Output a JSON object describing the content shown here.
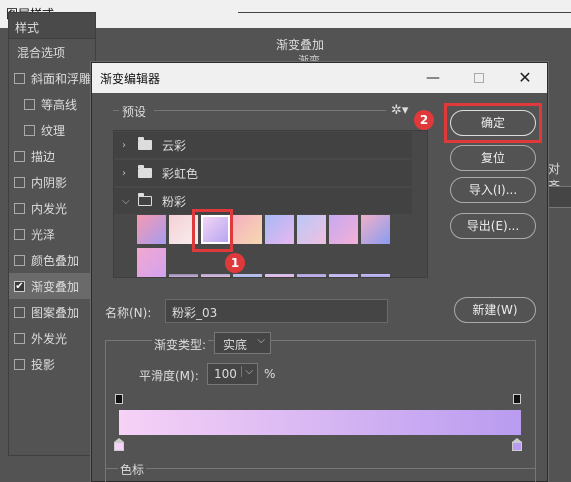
{
  "layer_style": {
    "title": "图层样式",
    "panel_header": "样式",
    "items": [
      {
        "label": "混合选项",
        "checkbox": false,
        "checked": false,
        "indent": false
      },
      {
        "label": "斜面和浮雕",
        "checkbox": true,
        "checked": false,
        "indent": false
      },
      {
        "label": "等高线",
        "checkbox": true,
        "checked": false,
        "indent": true
      },
      {
        "label": "纹理",
        "checkbox": true,
        "checked": false,
        "indent": true
      },
      {
        "label": "描边",
        "checkbox": true,
        "checked": false,
        "indent": false
      },
      {
        "label": "内阴影",
        "checkbox": true,
        "checked": false,
        "indent": false
      },
      {
        "label": "内发光",
        "checkbox": true,
        "checked": false,
        "indent": false
      },
      {
        "label": "光泽",
        "checkbox": true,
        "checked": false,
        "indent": false
      },
      {
        "label": "颜色叠加",
        "checkbox": true,
        "checked": false,
        "indent": false
      },
      {
        "label": "渐变叠加",
        "checkbox": true,
        "checked": true,
        "indent": false
      },
      {
        "label": "图案叠加",
        "checkbox": true,
        "checked": false,
        "indent": false
      },
      {
        "label": "外发光",
        "checkbox": true,
        "checked": false,
        "indent": false
      },
      {
        "label": "投影",
        "checkbox": true,
        "checked": false,
        "indent": false
      }
    ],
    "active_item": "渐变叠加",
    "right_group_title": "渐变叠加",
    "right_sub": "渐变",
    "align_fragment": "对齐"
  },
  "gradient_editor": {
    "title": "渐变编辑器",
    "presets_label": "预设",
    "folders": [
      {
        "name": "云彩",
        "open": false
      },
      {
        "name": "彩虹色",
        "open": false
      },
      {
        "name": "粉彩",
        "open": true
      }
    ],
    "swatches_row1": [
      [
        "#f59ab0",
        "#a79cf0"
      ],
      [
        "#f4d0d4",
        "#f9eef0"
      ],
      [
        "#f3d5f5",
        "#b7a5f2"
      ],
      [
        "#f4b0c0",
        "#f7d8b0"
      ],
      [
        "#a8b8f5",
        "#e8b8f0"
      ],
      [
        "#b9c8f8",
        "#f0c0e0"
      ],
      [
        "#c7a8f0",
        "#f3b0d8"
      ],
      [
        "#f0b0c8",
        "#8a9cf0"
      ]
    ],
    "swatches_row2": [
      [
        "#f3a8d0",
        "#d2a2ee"
      ],
      [
        "#8c8aa8",
        "#d0b0e0"
      ],
      [
        "#b0a0d0",
        "#e0c0d8"
      ],
      [
        "#c0b8e8",
        "#a8c0f0"
      ],
      [
        "#d0c0f0",
        "#e8b8e0"
      ],
      [
        "#a8a8d8",
        "#c8b0f0"
      ],
      [
        "#b8b0e8",
        "#d0c0f8"
      ],
      [
        "#c8b8f0",
        "#a8a8e8"
      ]
    ],
    "selected_swatch_index": 2,
    "buttons": {
      "ok": "确定",
      "reset": "复位",
      "import": "导入(I)...",
      "export": "导出(E)...",
      "new": "新建(W)"
    },
    "name_label": "名称(N):",
    "name_value": "粉彩_03",
    "gradient_type_label": "渐变类型:",
    "gradient_type_value": "实底",
    "smoothness_label": "平滑度(M):",
    "smoothness_value": "100",
    "smoothness_unit": "%",
    "gradient_colors": [
      "#f6d2f6",
      "#b99bf0"
    ],
    "stops_label": "色标",
    "annotations": [
      "1",
      "2"
    ],
    "accent_color": "#e0393b"
  }
}
